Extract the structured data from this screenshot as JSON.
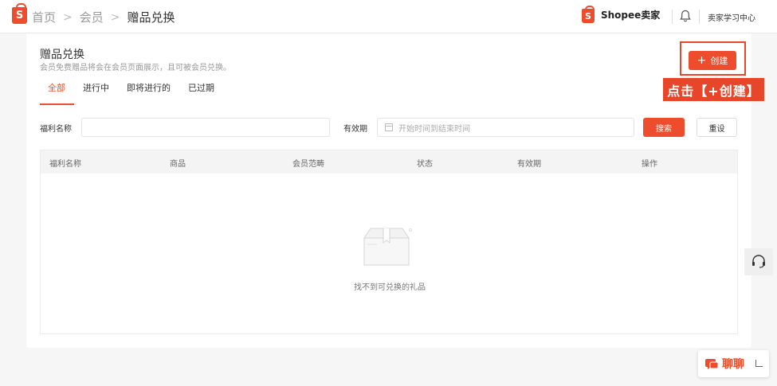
{
  "breadcrumb": {
    "home": "首页",
    "member": "会员",
    "current": "赠品兑换",
    "separator": ">"
  },
  "logo_letter": "S",
  "header": {
    "brand": "Shopee卖家",
    "learning_center": "卖家学习中心"
  },
  "page": {
    "title": "赠品兑换",
    "subtitle": "会员免费赠品将会在会员页面展示，且可被会员兑换。",
    "create_button": "创建",
    "create_icon": "+",
    "annotation": "点击【+创建】"
  },
  "tabs": [
    "全部",
    "进行中",
    "即将进行的",
    "已过期"
  ],
  "filters": {
    "name_label": "福利名称",
    "name_value": "",
    "period_label": "有效期",
    "period_placeholder": "开始时间到结束时间",
    "search_button": "搜索",
    "reset_button": "重设"
  },
  "table": {
    "columns": [
      "福利名称",
      "商品",
      "会员范畴",
      "状态",
      "有效期",
      "操作"
    ],
    "empty_text": "找不到可兑换的礼品"
  },
  "chat": {
    "label": "聊聊"
  },
  "colors": {
    "accent": "#ee4d2d",
    "annotation": "#e8462a"
  }
}
